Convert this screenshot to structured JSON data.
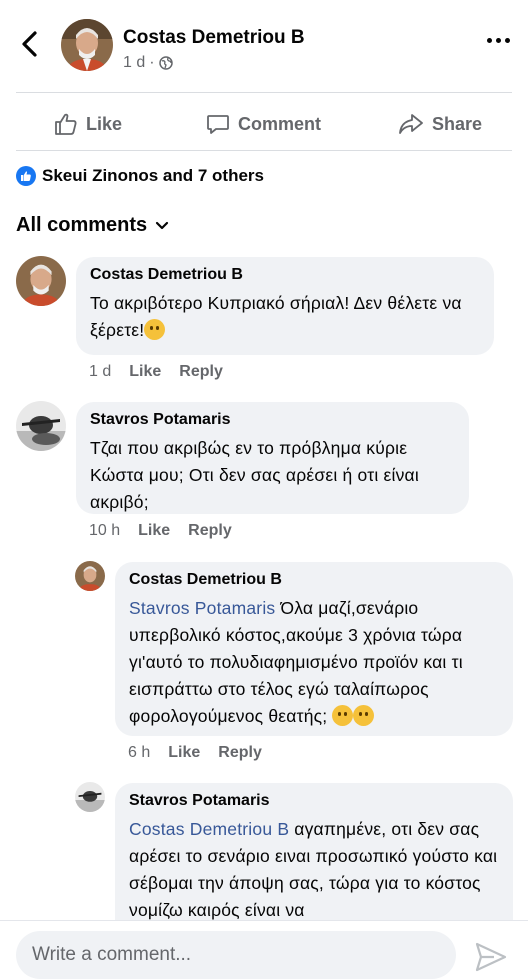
{
  "post_header": {
    "author": "Costas Demetriou B",
    "time": "1 d",
    "separator": "·",
    "privacy_icon": "globe-icon"
  },
  "actions": {
    "like": "Like",
    "comment": "Comment",
    "share": "Share"
  },
  "reactions": {
    "text": "Skeui Zinonos and 7 others"
  },
  "comments_header": {
    "label": "All comments"
  },
  "comments": [
    {
      "author": "Costas Demetriou B",
      "text": "Το ακριβότερο Κυπριακό σήριαλ! Δεν θέλετε να ξέρετε!",
      "emoji": [
        "thinking-face"
      ],
      "time": "1 d",
      "like": "Like",
      "reply": "Reply"
    },
    {
      "author": "Stavros Potamaris",
      "text": "Τζαι που ακριβώς εν το πρόβλημα κύριε Κώστα μου; Οτι δεν σας αρέσει ή οτι είναι ακριβό;",
      "time": "10 h",
      "like": "Like",
      "reply": "Reply"
    },
    {
      "author": "Costas Demetriou B",
      "mention": "Stavros Potamaris",
      "text": "Όλα μαζί,σενάριο υπερβολικό κόστος,ακούμε 3 χρόνια τώρα γι'αυτό το πολυδιαφημισμένο προϊόν και τι εισπράττω στο τέλος εγώ ταλαίπωρος φορολογούμενος θεατής;",
      "emoji": [
        "thinking-face",
        "pensive-face"
      ],
      "time": "6 h",
      "like": "Like",
      "reply": "Reply"
    },
    {
      "author": "Stavros Potamaris",
      "mention": "Costas Demetriou B",
      "text": "αγαπημένε, οτι δεν σας αρέσει το σενάριο ειναι προσωπικό γούστο και σέβομαι την άποψη σας, τώρα για το κόστος νομίζω καιρός είναι να"
    }
  ],
  "composer": {
    "placeholder": "Write a comment...",
    "send_icon": "send-icon"
  },
  "colors": {
    "facebook_blue": "#1877f2",
    "mention": "#385898",
    "bubble": "#f0f2f5",
    "secondary_text": "#65676b"
  }
}
